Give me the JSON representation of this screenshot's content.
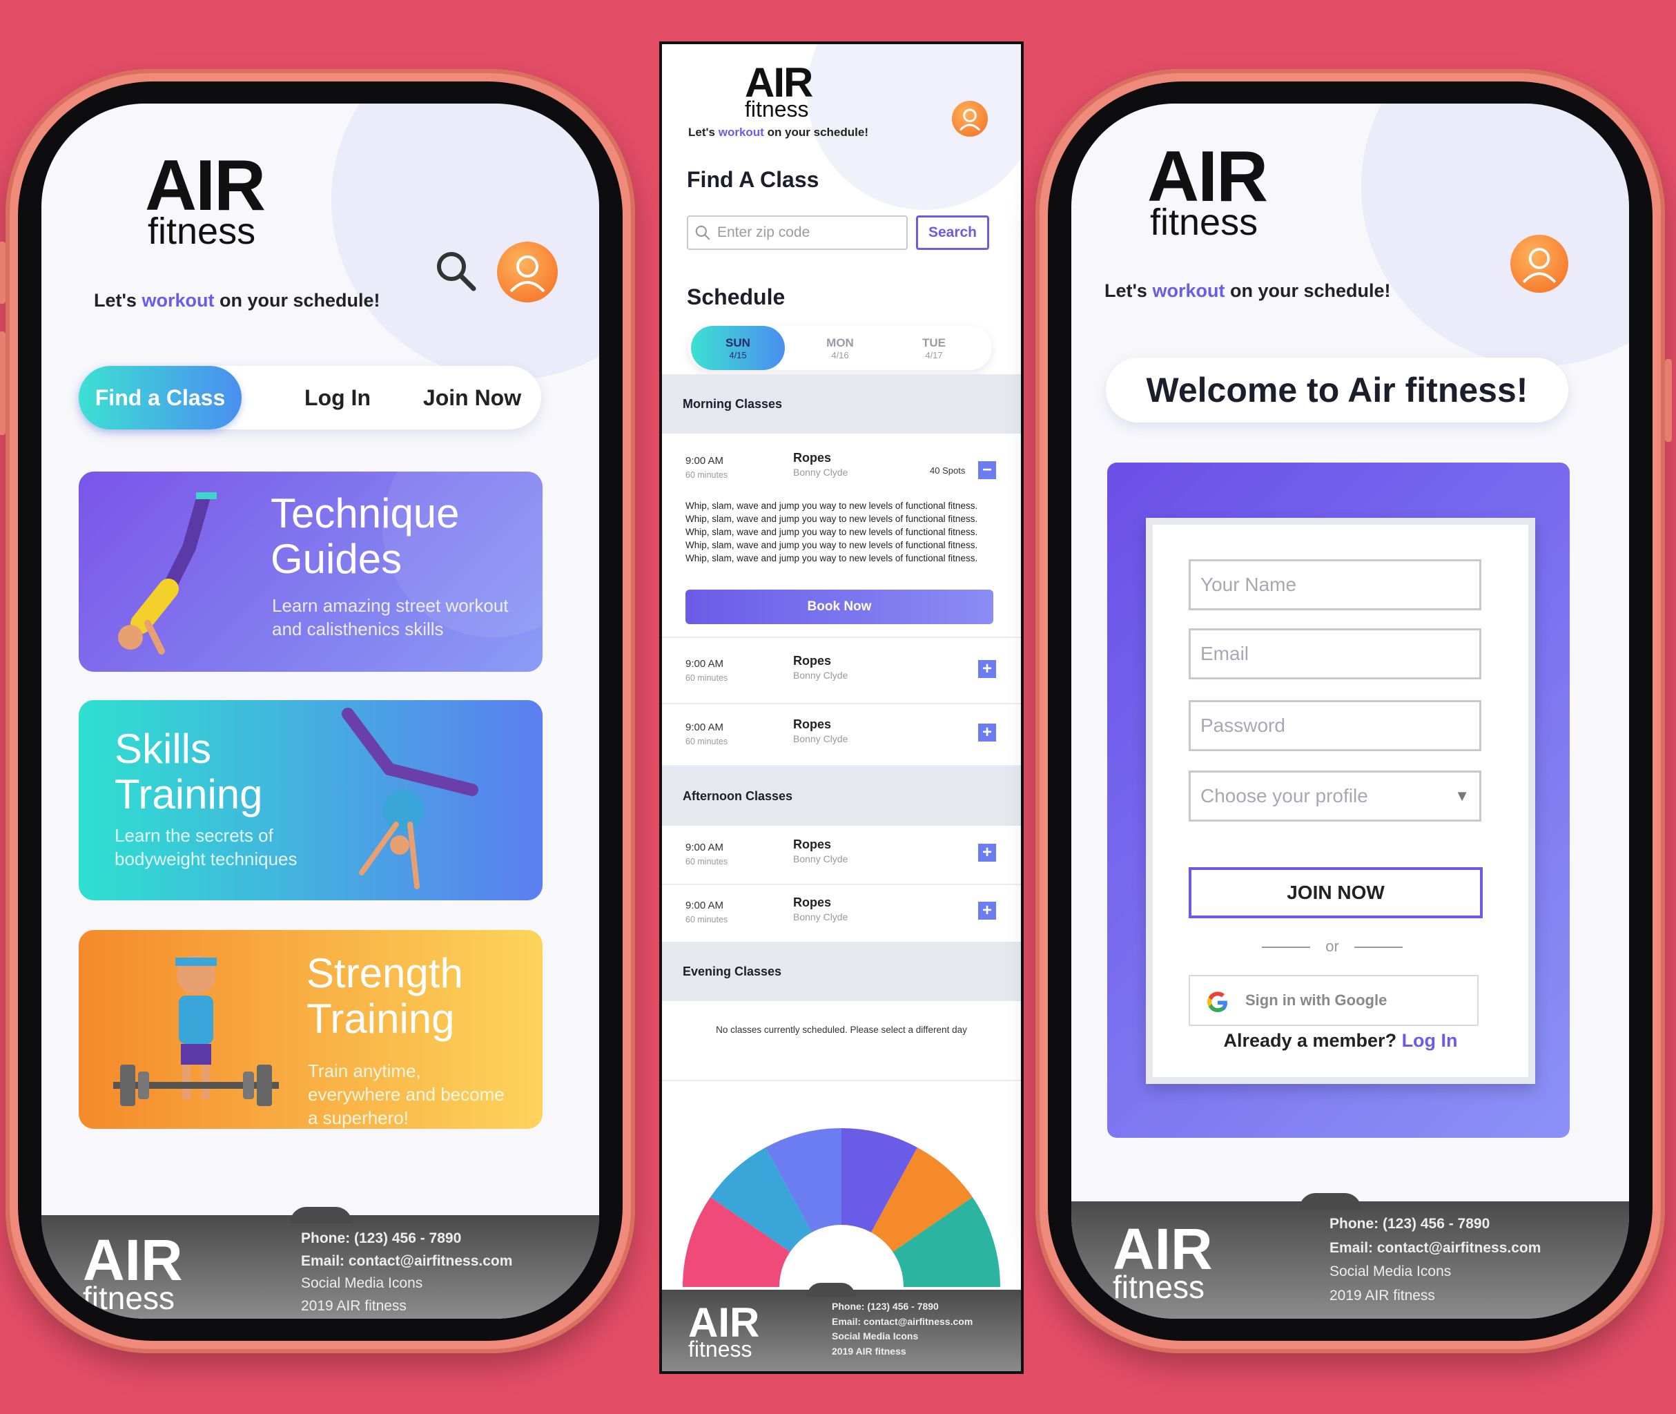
{
  "brand": {
    "air": "AIR",
    "fitness": "fitness"
  },
  "tagline": {
    "pre": "Let's ",
    "highlight": "workout",
    "post": " on your schedule!"
  },
  "colors": {
    "background": "#e44d66",
    "accent": "#6b5ce7",
    "teal": "#3de0d2",
    "orange": "#f59a2b"
  },
  "phone1": {
    "tabs": [
      {
        "label": "Find a Class"
      },
      {
        "label": "Log In"
      },
      {
        "label": "Join Now"
      }
    ],
    "cards": [
      {
        "title1": "Technique",
        "title2": "Guides",
        "sub1": "Learn amazing street workout",
        "sub2": "and calisthenics skills"
      },
      {
        "title1": "Skills",
        "title2": "Training",
        "sub1": "Learn the secrets of",
        "sub2": "bodyweight techniques"
      },
      {
        "title1": "Strength",
        "title2": "Training",
        "sub1": "Train anytime,",
        "sub2": "everywhere and become",
        "sub3": "a superhero!"
      }
    ]
  },
  "footer": {
    "phone": "Phone: (123) 456 - 7890",
    "email": "Email: contact@airfitness.com",
    "social": "Social Media Icons",
    "copyright": "2019 AIR fitness"
  },
  "mid": {
    "find_title": "Find A Class",
    "zip_placeholder": "Enter zip code",
    "search_label": "Search",
    "schedule_title": "Schedule",
    "days": [
      {
        "name": "SUN",
        "date": "4/15"
      },
      {
        "name": "MON",
        "date": "4/16"
      },
      {
        "name": "TUE",
        "date": "4/17"
      }
    ],
    "morning": "Morning Classes",
    "afternoon": "Afternoon Classes",
    "evening": "Evening Classes",
    "class": {
      "time": "9:00 AM",
      "duration": "60 minutes",
      "name": "Ropes",
      "instructor": "Bonny Clyde",
      "spots": "40 Spots"
    },
    "description": "Whip, slam, wave and jump you way to new levels of functional fitness. Whip, slam, wave and jump you way to new levels of functional fitness. Whip, slam, wave and jump you way to new levels of functional fitness. Whip, slam, wave and jump you way to new levels of functional fitness. Whip, slam, wave and jump you way to new levels of functional fitness.",
    "book_label": "Book Now",
    "no_classes": "No classes currently scheduled. Please select a different day"
  },
  "phone3": {
    "welcome": "Welcome to Air fitness!",
    "name_placeholder": "Your Name",
    "email_placeholder": "Email",
    "password_placeholder": "Password",
    "profile_placeholder": "Choose your profile",
    "join_label": "JOIN NOW",
    "or": "or",
    "google_label": "Sign in with Google",
    "member_text": "Already a member? ",
    "login_link": "Log In"
  }
}
